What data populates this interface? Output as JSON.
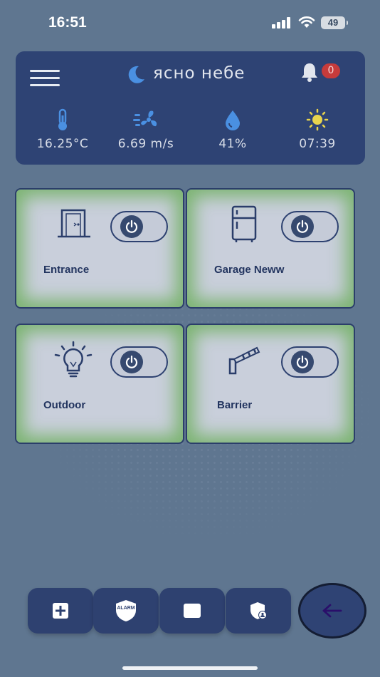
{
  "status_bar": {
    "time": "16:51",
    "battery": "49"
  },
  "weather": {
    "title": "ясно небе",
    "notification_count": "0",
    "temperature": "16.25°C",
    "wind": "6.69 m/s",
    "humidity": "41%",
    "sunrise": "07:39"
  },
  "devices": [
    {
      "label": "Entrance",
      "icon": "door-icon"
    },
    {
      "label": "Garage Neww",
      "icon": "fridge-icon"
    },
    {
      "label": "Outdoor",
      "icon": "lightbulb-icon"
    },
    {
      "label": "Barrier",
      "icon": "barrier-icon"
    }
  ],
  "bottom_nav": {
    "alarm_label": "ALARM"
  },
  "colors": {
    "background": "#5f7690",
    "card": "#2e4374",
    "device_glow": "#6eaf5f",
    "badge": "#c63b3b",
    "accent_blue": "#4a90e2",
    "sun": "#e8d44d"
  }
}
